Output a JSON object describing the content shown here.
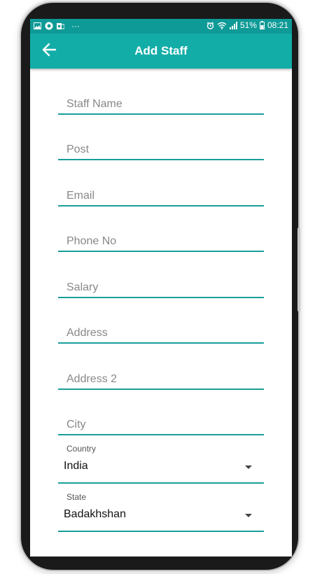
{
  "status_bar": {
    "battery": "51%",
    "time": "08:21",
    "dots": "···",
    "icons_left": [
      "image-icon",
      "camera-app-icon",
      "outlook-icon"
    ],
    "icons_right": [
      "alarm-icon",
      "wifi-icon",
      "signal-icon",
      "battery-icon"
    ]
  },
  "app_bar": {
    "title": "Add Staff",
    "back_icon": "arrow-left-icon"
  },
  "form": {
    "staff_name": {
      "placeholder": "Staff Name",
      "value": ""
    },
    "post": {
      "placeholder": "Post",
      "value": ""
    },
    "email": {
      "placeholder": "Email",
      "value": ""
    },
    "phone": {
      "placeholder": "Phone No",
      "value": ""
    },
    "salary": {
      "placeholder": "Salary",
      "value": ""
    },
    "address": {
      "placeholder": "Address",
      "value": ""
    },
    "address2": {
      "placeholder": "Address 2",
      "value": ""
    },
    "city": {
      "placeholder": "City",
      "value": ""
    },
    "country": {
      "label": "Country",
      "selected": "India"
    },
    "state": {
      "label": "State",
      "selected": "Badakhshan"
    }
  },
  "colors": {
    "status_bar": "#0e9a96",
    "app_bar": "#13ada8",
    "underline": "#1a9e99"
  }
}
